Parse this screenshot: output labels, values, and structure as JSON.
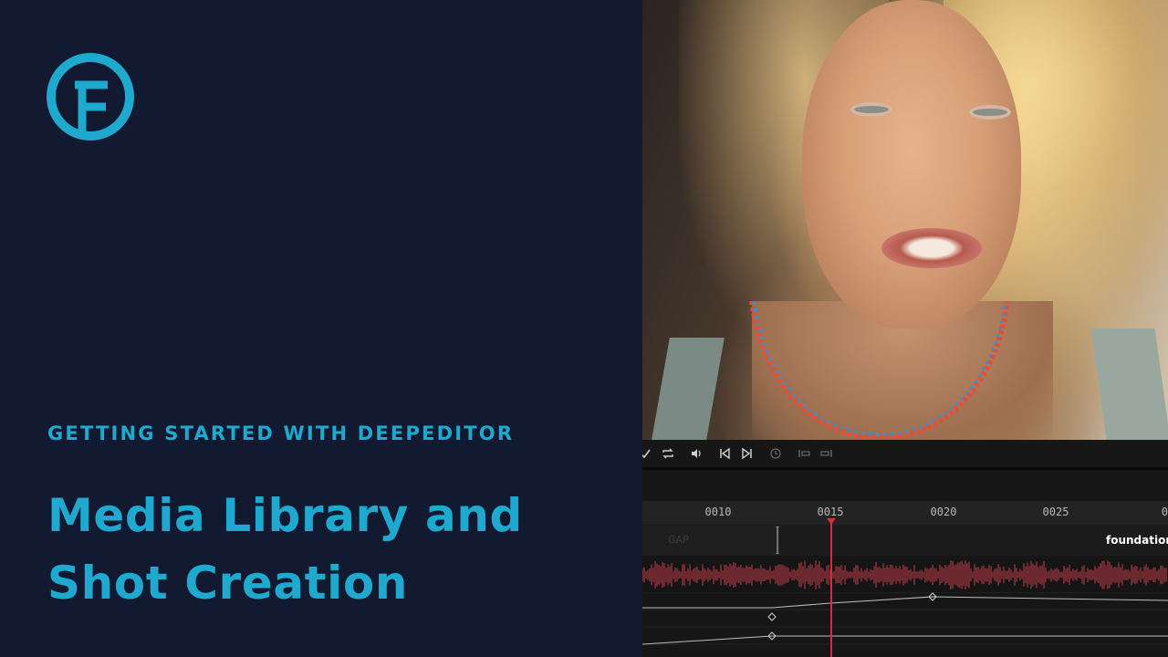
{
  "brand": {
    "logo_icon": "foundation-f-logo-icon",
    "accent": "#1fa9cf",
    "background": "#111a31"
  },
  "header": {
    "kicker": "GETTING STARTED WITH DEEPEDITOR",
    "title_line1": "Media Library and",
    "title_line2": "Shot Creation"
  },
  "toolbar": {
    "icons": [
      "check-icon",
      "loop-icon",
      "volume-icon",
      "skip-back-icon",
      "skip-forward-icon",
      "clock-icon",
      "trim-start-icon",
      "trim-end-icon"
    ]
  },
  "timeline": {
    "ruler_labels": [
      "0010",
      "0015",
      "0020",
      "0025",
      "00"
    ],
    "gap_label": "GAP",
    "clip_label": "foundation",
    "playhead_color": "#d32f3a",
    "waveform_color": "#c2404a"
  }
}
